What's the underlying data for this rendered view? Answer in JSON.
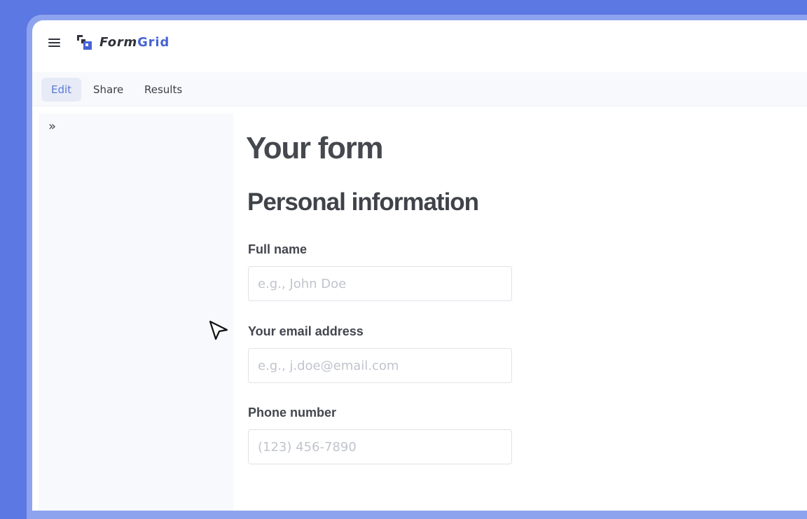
{
  "app": {
    "brand_part1": "Form",
    "brand_part2": "Grid"
  },
  "tabs": [
    {
      "label": "Edit",
      "active": true
    },
    {
      "label": "Share",
      "active": false
    },
    {
      "label": "Results",
      "active": false
    }
  ],
  "sidebar": {
    "expand_icon": "»"
  },
  "form": {
    "title": "Your form",
    "section_title": "Personal information",
    "fields": [
      {
        "label": "Full name",
        "placeholder": "e.g., John Doe",
        "value": ""
      },
      {
        "label": "Your email address",
        "placeholder": "e.g., j.doe@email.com",
        "value": ""
      },
      {
        "label": "Phone number",
        "placeholder": "(123) 456-7890",
        "value": ""
      }
    ]
  },
  "colors": {
    "background": "#5c78e3",
    "accent": "#4664d6",
    "active_tab_bg": "#e7ebf7",
    "active_tab_text": "#5a79d5"
  },
  "icons": [
    "hamburger-menu-icon",
    "formgrid-logo-icon",
    "expand-sidebar-icon",
    "mouse-cursor-icon"
  ]
}
